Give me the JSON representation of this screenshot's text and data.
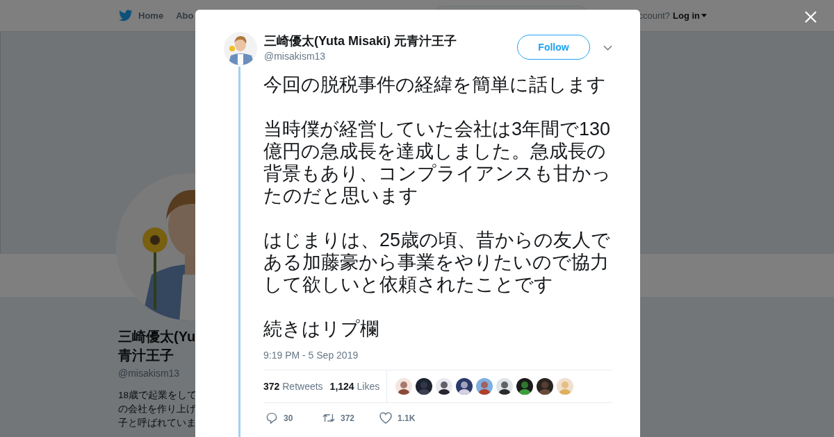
{
  "nav": {
    "items": [
      "Home",
      "Abo"
    ],
    "account_prompt": "ccount?",
    "login": "Log in"
  },
  "profile": {
    "name_lines": [
      "三崎優太(Yu",
      "青汁王子"
    ],
    "handle": "@misakism13",
    "bio_lines": [
      "18歳で起業をして",
      "の会社を作り上げ",
      "子と呼ばれていま"
    ]
  },
  "tweet": {
    "author": "三崎優太(Yuta Misaki) 元青汁王子",
    "handle": "@misakism13",
    "follow": "Follow",
    "paragraphs": [
      "今回の脱税事件の経緯を簡単に話します",
      "当時僕が経営していた会社は3年間で130億円の急成長を達成しました。急成長の背景もあり、コンプライアンスも甘かったのだと思います",
      "はじまりは、25歳の頃、昔からの友人である加藤豪から事業をやりたいので協力して欲しいと依頼されたことです",
      "続きはリプ欄"
    ],
    "timestamp": "9:19 PM - 5 Sep 2019",
    "stats": [
      {
        "count": "372",
        "label": "Retweets"
      },
      {
        "count": "1,124",
        "label": "Likes"
      }
    ],
    "actions": [
      {
        "kind": "reply",
        "count": "30"
      },
      {
        "kind": "retweet",
        "count": "372"
      },
      {
        "kind": "like",
        "count": "1.1K"
      }
    ]
  }
}
